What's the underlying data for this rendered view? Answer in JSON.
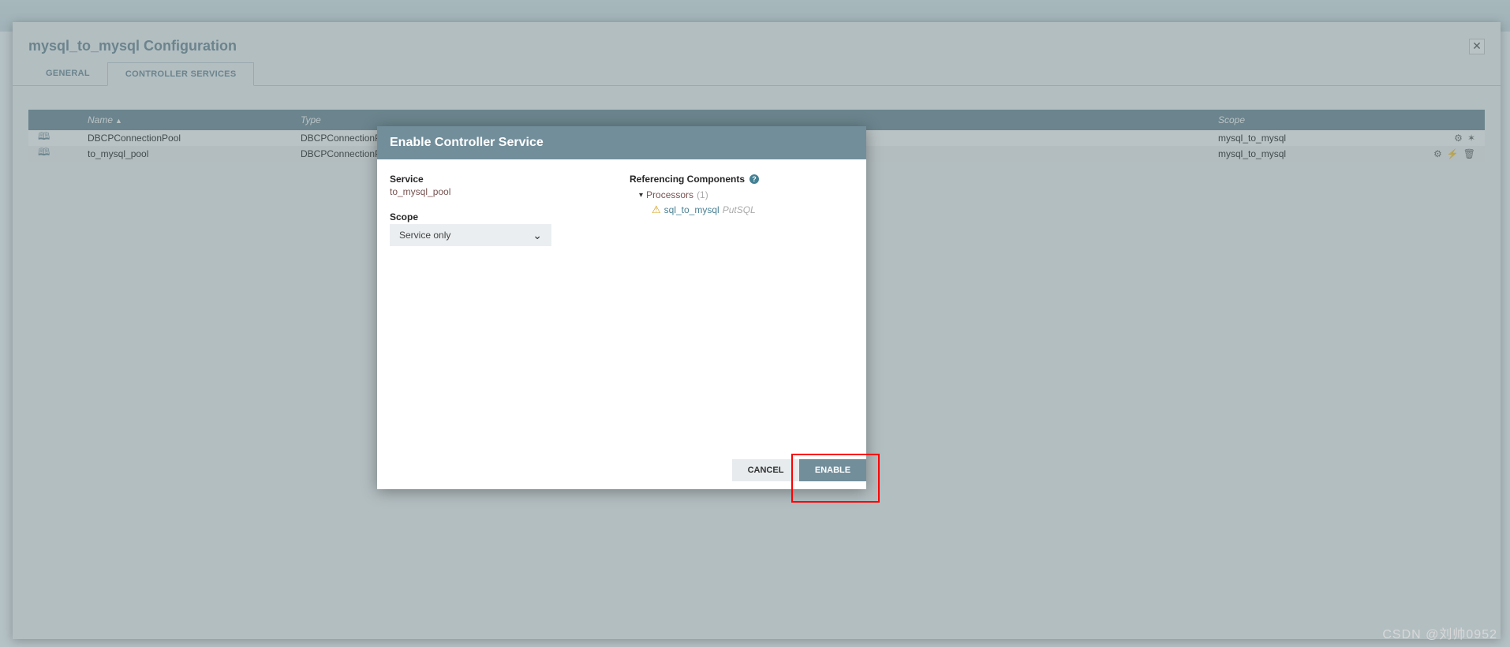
{
  "config": {
    "title": "mysql_to_mysql Configuration",
    "tabs": {
      "general": "GENERAL",
      "controller": "CONTROLLER SERVICES"
    }
  },
  "table": {
    "headers": {
      "name": "Name",
      "type": "Type",
      "scope": "Scope"
    },
    "rows": [
      {
        "name": "DBCPConnectionPool",
        "type": "DBCPConnectionPo",
        "scope": "mysql_to_mysql",
        "actions": [
          "gear",
          "person"
        ]
      },
      {
        "name": "to_mysql_pool",
        "type": "DBCPConnectionPo",
        "scope": "mysql_to_mysql",
        "actions": [
          "gear",
          "bolt",
          "trash"
        ]
      }
    ]
  },
  "modal": {
    "title": "Enable Controller Service",
    "service_label": "Service",
    "service_value": "to_mysql_pool",
    "scope_label": "Scope",
    "scope_value": "Service only",
    "ref_label": "Referencing Components",
    "processors_label": "Processors",
    "processors_count": "(1)",
    "comp_name": "sql_to_mysql",
    "comp_type": "PutSQL",
    "cancel": "CANCEL",
    "enable": "ENABLE"
  },
  "watermark": "CSDN @刘帅0952"
}
